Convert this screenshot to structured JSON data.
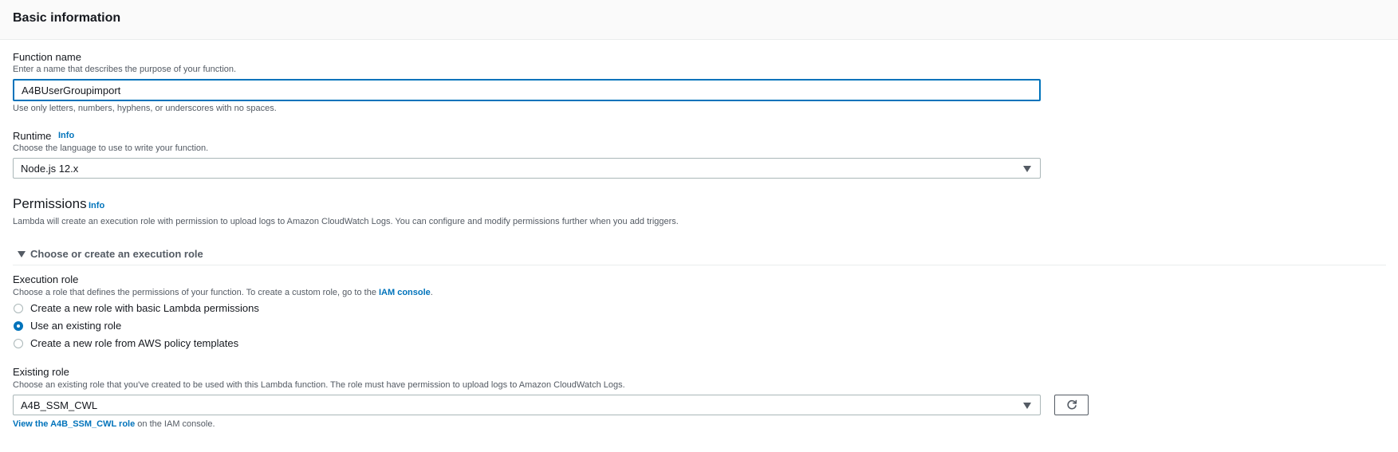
{
  "header": {
    "title": "Basic information"
  },
  "function_name": {
    "label": "Function name",
    "description": "Enter a name that describes the purpose of your function.",
    "value": "A4BUserGroupimport",
    "constraint": "Use only letters, numbers, hyphens, or underscores with no spaces."
  },
  "runtime": {
    "label": "Runtime",
    "info": "Info",
    "description": "Choose the language to use to write your function.",
    "value": "Node.js 12.x"
  },
  "permissions": {
    "title": "Permissions",
    "info": "Info",
    "description": "Lambda will create an execution role with permission to upload logs to Amazon CloudWatch Logs. You can configure and modify permissions further when you add triggers.",
    "expander_label": "Choose or create an execution role"
  },
  "execution_role": {
    "label": "Execution role",
    "description_prefix": "Choose a role that defines the permissions of your function. To create a custom role, go to the ",
    "iam_console_link": "IAM console",
    "description_suffix": ".",
    "options": [
      {
        "label": "Create a new role with basic Lambda permissions",
        "selected": false
      },
      {
        "label": "Use an existing role",
        "selected": true
      },
      {
        "label": "Create a new role from AWS policy templates",
        "selected": false
      }
    ]
  },
  "existing_role": {
    "label": "Existing role",
    "description": "Choose an existing role that you've created to be used with this Lambda function. The role must have permission to upload logs to Amazon CloudWatch Logs.",
    "value": "A4B_SSM_CWL",
    "view_link": "View the A4B_SSM_CWL role",
    "view_suffix": " on the IAM console.",
    "refresh_icon": "refresh-icon"
  },
  "colors": {
    "accent": "#0073bb",
    "text": "#16191f",
    "muted": "#545b64",
    "border": "#aab7b8"
  }
}
